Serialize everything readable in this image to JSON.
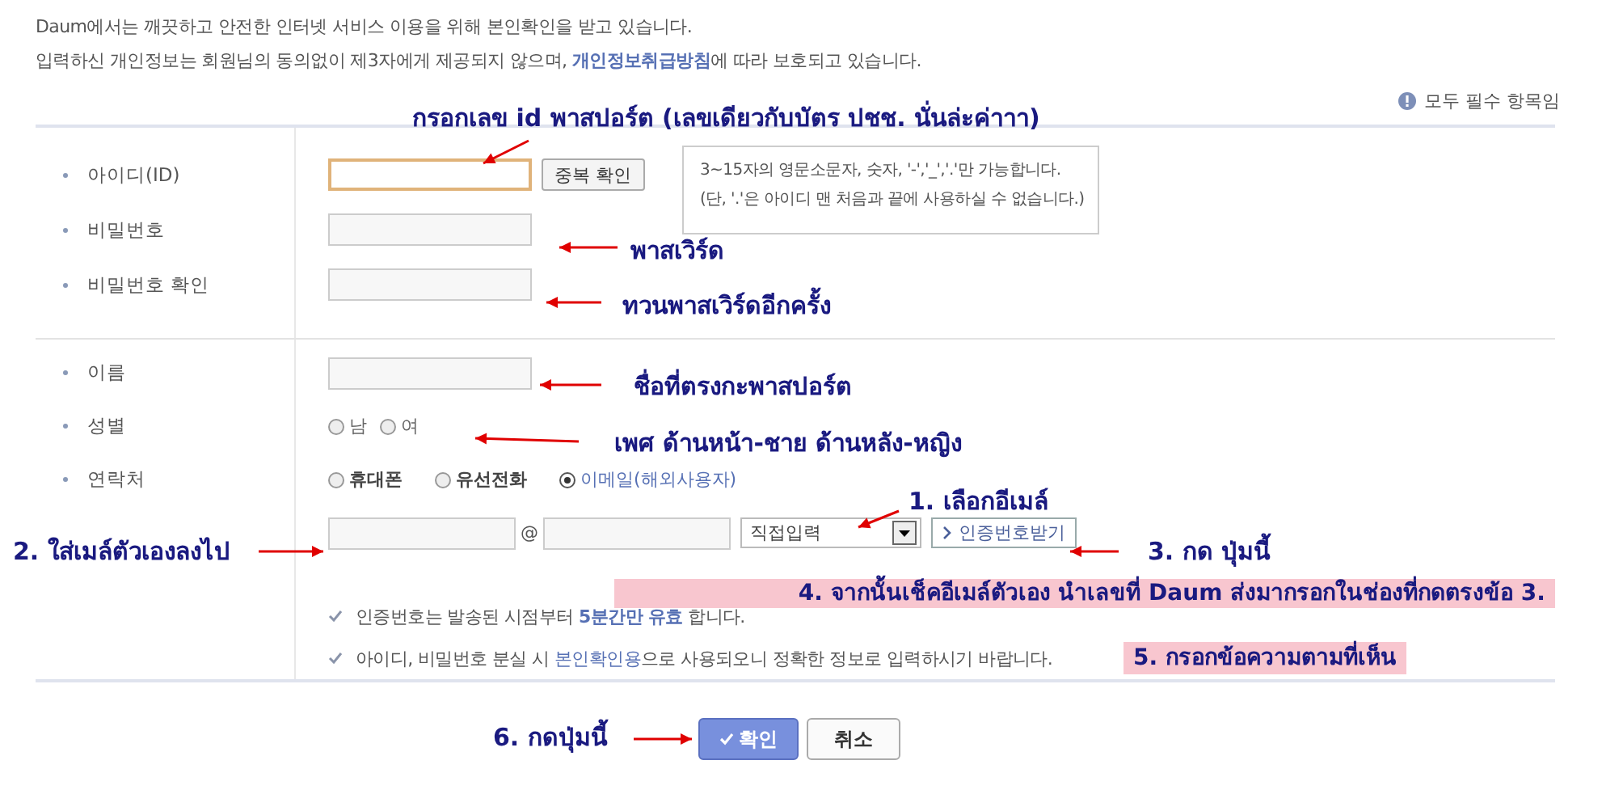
{
  "intro": {
    "line_1": "Daum에서는 깨끗하고 안전한 인터넷 서비스 이용을 위해 본인확인을 받고 있습니다.",
    "line_2_before": "입력하신 개인정보는 회원님의 동의없이 제3자에게 제공되지 않으며, ",
    "line_2_link": "개인정보취급방침",
    "line_2_after": "에 따라 보호되고 있습니다."
  },
  "required_note": "모두 필수 항목임",
  "account_fields": [
    {
      "label": "아이디(ID)",
      "focused": true,
      "button": "중복 확인"
    },
    {
      "label": "비밀번호",
      "focused": false
    },
    {
      "label": "비밀번호 확인",
      "focused": false
    }
  ],
  "tooltip": [
    "3~15자의 영문소문자, 숫자, '-','_','.'만 가능합니다.",
    "(단, '.'은 아이디 맨 처음과 끝에 사용하실 수 없습니다.)"
  ],
  "name_field": {
    "label": "이름",
    "focused": false
  },
  "gender": {
    "label": "성별",
    "options": [
      {
        "label": "남",
        "selected": false
      },
      {
        "label": "여",
        "selected": false
      }
    ]
  },
  "contact": {
    "label": "연락처",
    "options": [
      {
        "label": "휴대폰",
        "selected": false
      },
      {
        "label": "유선전화",
        "selected": false
      },
      {
        "label": "이메일(해외사용자)",
        "selected": true
      }
    ]
  },
  "email": {
    "at": "@",
    "domain_select": "직접입력",
    "button": "인증번호받기"
  },
  "notices": [
    {
      "before": "인증번호는 발송된 시점부터 ",
      "link": "5분간만 유효",
      "link_bold": true,
      "after": " 합니다."
    },
    {
      "before": "아이디, 비밀번호 분실 시 ",
      "link": "본인확인용",
      "link_bold": false,
      "after": "으로 사용되오니 정확한 정보로 입력하시기 바랍니다."
    }
  ],
  "buttons": [
    {
      "label": "확인",
      "kind": "primary"
    },
    {
      "label": "취소",
      "kind": "secondary"
    }
  ],
  "annotations": [
    {
      "text": "กรอกเลข id พาสปอร์ต (เลขเดียวกับบัตร ปชช. นั่นล่ะค่าาา)",
      "kind": "label"
    },
    {
      "text": "พาสเวิร์ด",
      "kind": "label"
    },
    {
      "text": "ทวนพาสเวิร์ดอีกครั้ง",
      "kind": "label"
    },
    {
      "text": "ชื่อที่ตรงกะพาสปอร์ต",
      "kind": "label"
    },
    {
      "text": "เพศ ด้านหน้า-ชาย ด้านหลัง-หญิง",
      "kind": "label"
    },
    {
      "text": "1. เลือกอีเมล์",
      "kind": "label"
    },
    {
      "text": "2. ใส่เมล์ตัวเองลงไป",
      "kind": "label"
    },
    {
      "text": "3. กด ปุ่มนี้",
      "kind": "label"
    },
    {
      "text": "4. จากนั้นเช็คอีเมล์ตัวเอง นำเลขที่ Daum ส่งมากรอกในช่องที่กดตรงข้อ 3.",
      "kind": "highlight"
    },
    {
      "text": "5. กรอกข้อความตามที่เห็น",
      "kind": "highlight"
    },
    {
      "text": "6. กดปุ่มนี้",
      "kind": "label"
    }
  ]
}
